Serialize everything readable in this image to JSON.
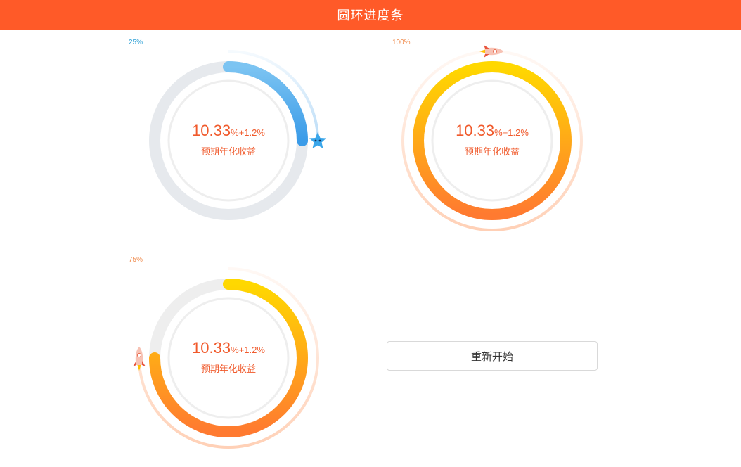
{
  "header": {
    "title": "圆环进度条"
  },
  "progress_rings": [
    {
      "percent_label": "25%",
      "progress": 0.25,
      "rate_main": "10.33",
      "rate_main_unit": "%",
      "rate_bonus": "+1.2",
      "rate_bonus_unit": "%",
      "description": "预期年化收益",
      "theme": "blue",
      "marker_icon": "star-character-icon",
      "colors": {
        "label": "#2a9fd6",
        "progress_start": "#7cc4f2",
        "progress_end": "#3a9be8",
        "track": "#e6e9ed"
      }
    },
    {
      "percent_label": "100%",
      "progress": 1.0,
      "rate_main": "10.33",
      "rate_main_unit": "%",
      "rate_bonus": "+1.2",
      "rate_bonus_unit": "%",
      "description": "预期年化收益",
      "theme": "orange",
      "marker_icon": "rocket-icon",
      "colors": {
        "label": "#f08a4b",
        "progress_start": "#ffd800",
        "progress_end": "#ff7a30",
        "track": "#eeeeee"
      }
    },
    {
      "percent_label": "75%",
      "progress": 0.75,
      "rate_main": "10.33",
      "rate_main_unit": "%",
      "rate_bonus": "+1.2",
      "rate_bonus_unit": "%",
      "description": "预期年化收益",
      "theme": "orange",
      "marker_icon": "rocket-icon",
      "colors": {
        "label": "#f08a4b",
        "progress_start": "#ffd800",
        "progress_end": "#ff7a30",
        "track": "#eeeeee"
      }
    }
  ],
  "restart_button": {
    "label": "重新开始"
  }
}
